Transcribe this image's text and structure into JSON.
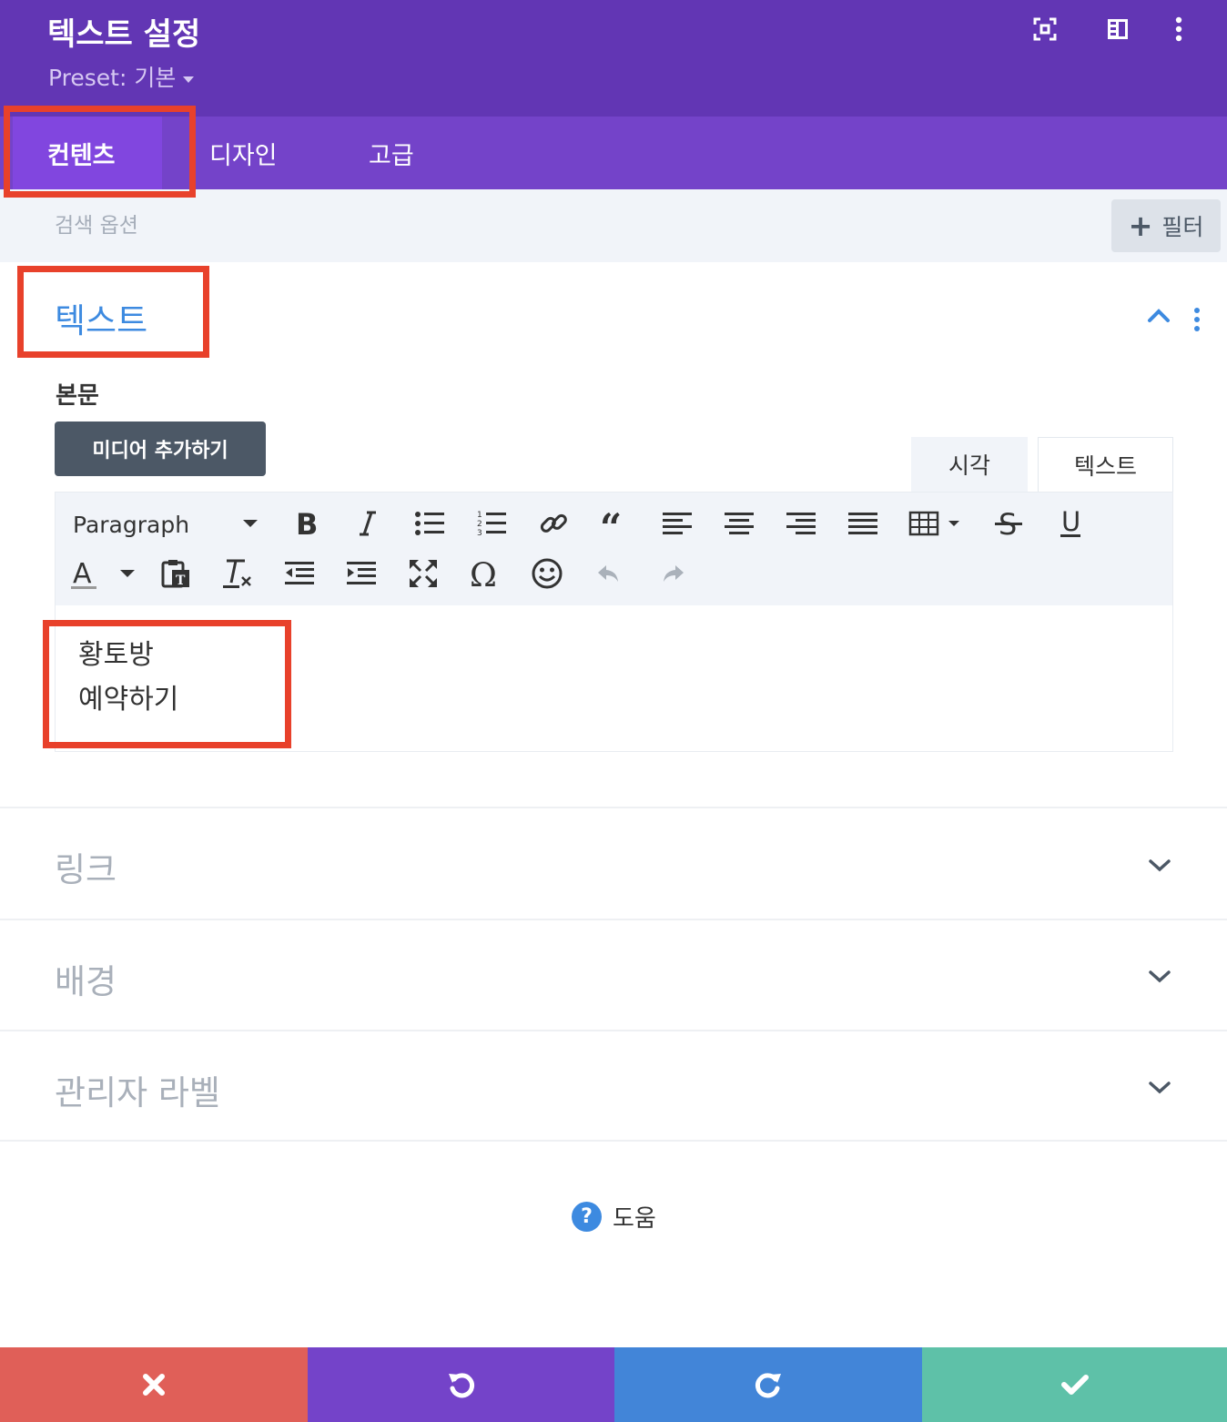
{
  "header": {
    "title": "텍스트 설정",
    "preset": "Preset: 기본",
    "icons": [
      "focus-icon",
      "sidebar-layout-icon",
      "more-vertical-icon"
    ]
  },
  "tabs": [
    "컨텐츠",
    "디자인",
    "고급"
  ],
  "search": {
    "placeholder": "검색 옵션",
    "filter_label": "필터"
  },
  "text_section": {
    "title": "텍스트",
    "body_label": "본문",
    "add_media": "미디어 추가하기",
    "mode_tabs": [
      "시각",
      "텍스트"
    ],
    "format_select": "Paragraph",
    "toolbar_row1": [
      "bold-icon",
      "italic-icon",
      "bullet-list-icon",
      "numbered-list-icon",
      "link-icon",
      "blockquote-icon",
      "align-left-icon",
      "align-center-icon",
      "align-right-icon",
      "align-justify-icon",
      "table-icon",
      "strikethrough-icon",
      "underline-icon"
    ],
    "toolbar_row2": [
      "text-color-icon",
      "paste-text-icon",
      "clear-format-icon",
      "outdent-icon",
      "indent-icon",
      "fullscreen-icon",
      "special-char-icon",
      "emoji-icon",
      "undo-icon",
      "redo-icon"
    ],
    "content_lines": [
      "황토방",
      "예약하기"
    ]
  },
  "collapsed_sections": [
    "링크",
    "배경",
    "관리자 라벨"
  ],
  "help_label": "도움",
  "footer": [
    "cancel-icon",
    "undo-icon",
    "redo-icon",
    "save-check-icon"
  ],
  "colors": {
    "header": "#6236b4",
    "tabs": "#7443c9",
    "active_tab": "#8146df",
    "accent_blue": "#3d8ae0",
    "cancel": "#e05f58",
    "undo": "#7443c9",
    "redo": "#4285d8",
    "save": "#5ec1a8",
    "highlight": "#e8412b"
  }
}
